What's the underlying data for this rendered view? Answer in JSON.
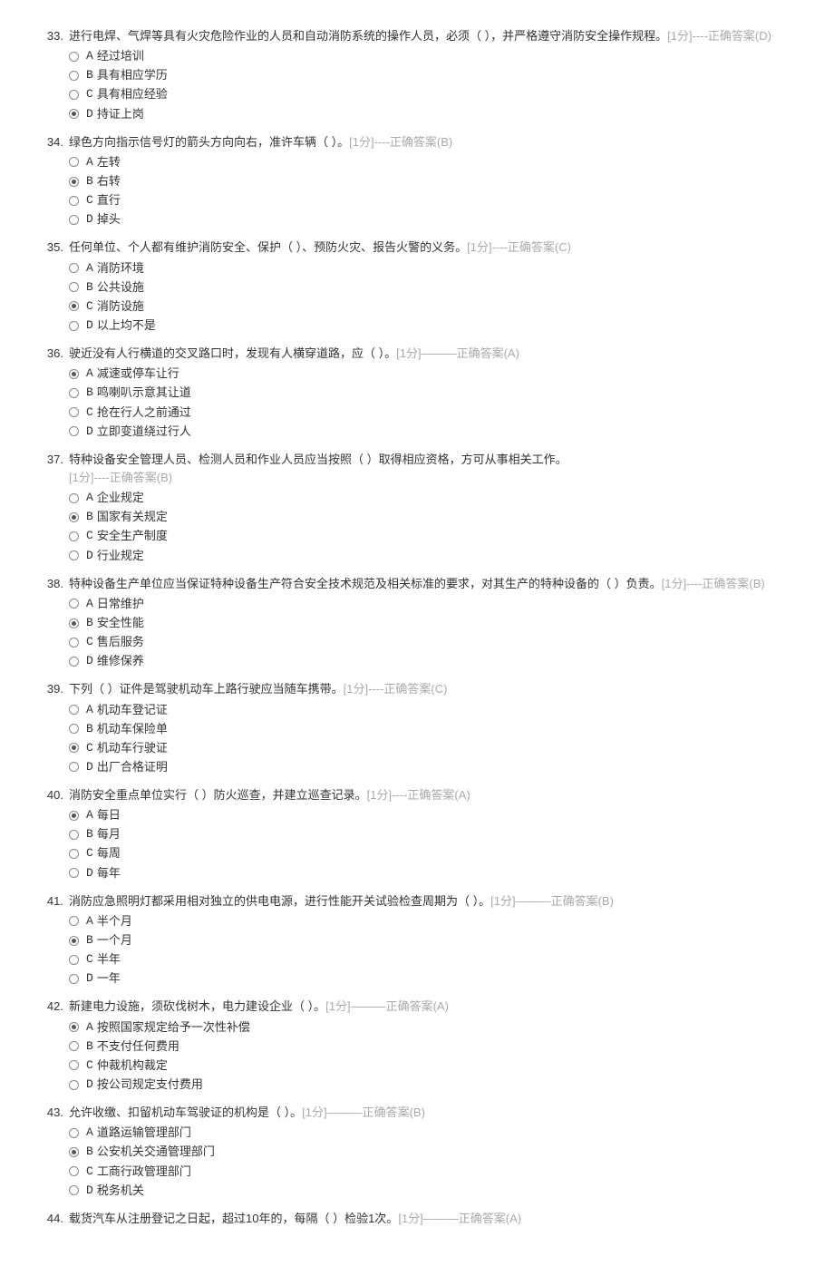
{
  "questions": [
    {
      "num": "33.",
      "stem": "进行电焊、气焊等具有火灾危险作业的人员和自动消防系统的操作人员，必须（ ），并严格遵守消防安全操作规程。",
      "meta": "[1分]----正确答案(D)",
      "options": [
        {
          "letter": "A",
          "text": "经过培训",
          "checked": false
        },
        {
          "letter": "B",
          "text": "具有相应学历",
          "checked": false
        },
        {
          "letter": "C",
          "text": "具有相应经验",
          "checked": false
        },
        {
          "letter": "D",
          "text": "持证上岗",
          "checked": true
        }
      ]
    },
    {
      "num": "34.",
      "stem": "绿色方向指示信号灯的箭头方向向右，准许车辆（ ）。",
      "meta": "[1分]----正确答案(B)",
      "options": [
        {
          "letter": "A",
          "text": "左转",
          "checked": false
        },
        {
          "letter": "B",
          "text": "右转",
          "checked": true
        },
        {
          "letter": "C",
          "text": "直行",
          "checked": false
        },
        {
          "letter": "D",
          "text": "掉头",
          "checked": false
        }
      ]
    },
    {
      "num": "35.",
      "stem": "任何单位、个人都有维护消防安全、保护（ ）、预防火灾、报告火警的义务。",
      "meta": "[1分]----正确答案(C)",
      "options": [
        {
          "letter": "A",
          "text": "消防环境",
          "checked": false
        },
        {
          "letter": "B",
          "text": "公共设施",
          "checked": false
        },
        {
          "letter": "C",
          "text": "消防设施",
          "checked": true
        },
        {
          "letter": "D",
          "text": "以上均不是",
          "checked": false
        }
      ]
    },
    {
      "num": "36.",
      "stem": "驶近没有人行横道的交叉路口时，发现有人横穿道路，应（ ）。",
      "meta": "[1分]———正确答案(A)",
      "options": [
        {
          "letter": "A",
          "text": "减速或停车让行",
          "checked": true
        },
        {
          "letter": "B",
          "text": "鸣喇叭示意其让道",
          "checked": false
        },
        {
          "letter": "C",
          "text": "抢在行人之前通过",
          "checked": false
        },
        {
          "letter": "D",
          "text": "立即变道绕过行人",
          "checked": false
        }
      ]
    },
    {
      "num": "37.",
      "stem": "特种设备安全管理人员、检测人员和作业人员应当按照（ ）取得相应资格，方可从事相关工作。",
      "meta": "[1分]----正确答案(B)",
      "meta_newline": true,
      "options": [
        {
          "letter": "A",
          "text": "企业规定",
          "checked": false
        },
        {
          "letter": "B",
          "text": "国家有关规定",
          "checked": true
        },
        {
          "letter": "C",
          "text": "安全生产制度",
          "checked": false
        },
        {
          "letter": "D",
          "text": "行业规定",
          "checked": false
        }
      ]
    },
    {
      "num": "38.",
      "stem": "特种设备生产单位应当保证特种设备生产符合安全技术规范及相关标准的要求，对其生产的特种设备的（ ）负责。",
      "meta": "[1分]----正确答案(B)",
      "options": [
        {
          "letter": "A",
          "text": "日常维护",
          "checked": false
        },
        {
          "letter": "B",
          "text": "安全性能",
          "checked": true
        },
        {
          "letter": "C",
          "text": "售后服务",
          "checked": false
        },
        {
          "letter": "D",
          "text": "维修保养",
          "checked": false
        }
      ]
    },
    {
      "num": "39.",
      "stem": "下列（ ）证件是驾驶机动车上路行驶应当随车携带。",
      "meta": "[1分]----正确答案(C)",
      "options": [
        {
          "letter": "A",
          "text": "机动车登记证",
          "checked": false
        },
        {
          "letter": "B",
          "text": "机动车保险单",
          "checked": false
        },
        {
          "letter": "C",
          "text": "机动车行驶证",
          "checked": true
        },
        {
          "letter": "D",
          "text": "出厂合格证明",
          "checked": false
        }
      ]
    },
    {
      "num": "40.",
      "stem": "消防安全重点单位实行（ ）防火巡查，并建立巡查记录。",
      "meta": "[1分]----正确答案(A)",
      "options": [
        {
          "letter": "A",
          "text": "每日",
          "checked": true
        },
        {
          "letter": "B",
          "text": "每月",
          "checked": false
        },
        {
          "letter": "C",
          "text": "每周",
          "checked": false
        },
        {
          "letter": "D",
          "text": "每年",
          "checked": false
        }
      ]
    },
    {
      "num": "41.",
      "stem": "消防应急照明灯都采用相对独立的供电电源，进行性能开关试验检查周期为（ ）。",
      "meta": "[1分]———正确答案(B)",
      "options": [
        {
          "letter": "A",
          "text": "半个月",
          "checked": false
        },
        {
          "letter": "B",
          "text": "一个月",
          "checked": true
        },
        {
          "letter": "C",
          "text": "半年",
          "checked": false
        },
        {
          "letter": "D",
          "text": "一年",
          "checked": false
        }
      ]
    },
    {
      "num": "42.",
      "stem": "新建电力设施，须砍伐树木，电力建设企业（ ）。",
      "meta": "[1分]———正确答案(A)",
      "options": [
        {
          "letter": "A",
          "text": "按照国家规定给予一次性补偿",
          "checked": true
        },
        {
          "letter": "B",
          "text": "不支付任何费用",
          "checked": false
        },
        {
          "letter": "C",
          "text": "仲裁机构裁定",
          "checked": false
        },
        {
          "letter": "D",
          "text": "按公司规定支付费用",
          "checked": false
        }
      ]
    },
    {
      "num": "43.",
      "stem": "允许收缴、扣留机动车驾驶证的机构是（ ）。",
      "meta": "[1分]———正确答案(B)",
      "options": [
        {
          "letter": "A",
          "text": "道路运输管理部门",
          "checked": false
        },
        {
          "letter": "B",
          "text": "公安机关交通管理部门",
          "checked": true
        },
        {
          "letter": "C",
          "text": "工商行政管理部门",
          "checked": false
        },
        {
          "letter": "D",
          "text": "税务机关",
          "checked": false
        }
      ]
    },
    {
      "num": "44.",
      "stem": "载货汽车从注册登记之日起，超过10年的，每隔（ ）检验1次。",
      "meta": "[1分]———正确答案(A)",
      "options": []
    }
  ]
}
